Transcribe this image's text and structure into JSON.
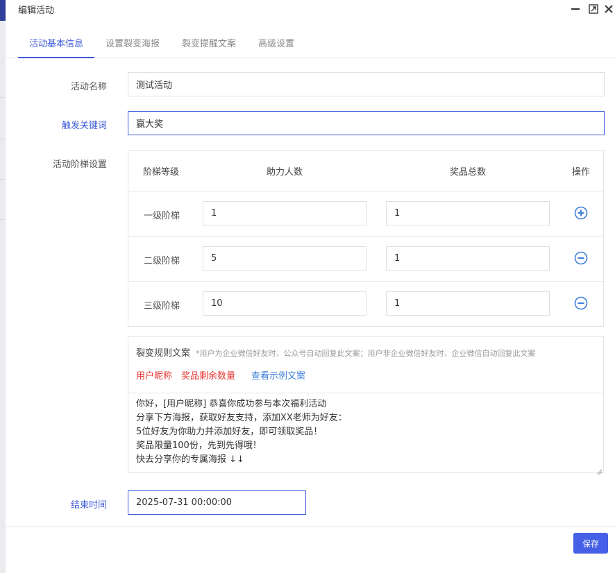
{
  "dialog": {
    "title": "编辑活动"
  },
  "tabs": [
    {
      "label": "活动基本信息",
      "active": true
    },
    {
      "label": "设置裂变海报",
      "active": false
    },
    {
      "label": "裂变提醒文案",
      "active": false
    },
    {
      "label": "高级设置",
      "active": false
    }
  ],
  "form": {
    "name_label": "活动名称",
    "name_value": "测试活动",
    "keyword_label": "触发关键词",
    "keyword_value": "赢大奖",
    "tier_label": "活动阶梯设置",
    "end_time_label": "结束时间",
    "end_time_value": "2025-07-31 00:00:00"
  },
  "tier_table": {
    "headers": {
      "level": "阶梯等级",
      "helpers": "助力人数",
      "prizes": "奖品总数",
      "action": "操作"
    },
    "rows": [
      {
        "level": "一级阶梯",
        "helpers": "1",
        "prizes": "1",
        "action_icon": "plus-circle-icon"
      },
      {
        "level": "二级阶梯",
        "helpers": "5",
        "prizes": "1",
        "action_icon": "minus-circle-icon"
      },
      {
        "level": "三级阶梯",
        "helpers": "10",
        "prizes": "1",
        "action_icon": "minus-circle-icon"
      }
    ]
  },
  "rule_text": {
    "title": "裂变规则文案",
    "hint": "*用户为企业微信好友时，公众号自动回复此文案；用户非企业微信好友时，企业微信自动回复此文案",
    "tags": [
      "用户昵称",
      "奖品剩余数量"
    ],
    "example_link": "查看示例文案",
    "lines": [
      "你好，[用户昵称] 恭喜你成功参与本次福利活动",
      "分享下方海报，获取好友支持，添加XX老师为好友：",
      "5位好友为你助力并添加好友，即可领取奖品！",
      "奖品限量100份，先到先得哦！",
      "快去分享你的专属海报 ↓↓"
    ]
  },
  "footer": {
    "save_label": "保存"
  },
  "colors": {
    "accent": "#3d5bd9",
    "button": "#4560e6",
    "tag_red": "#e53935",
    "link_blue": "#3d7fd9"
  }
}
